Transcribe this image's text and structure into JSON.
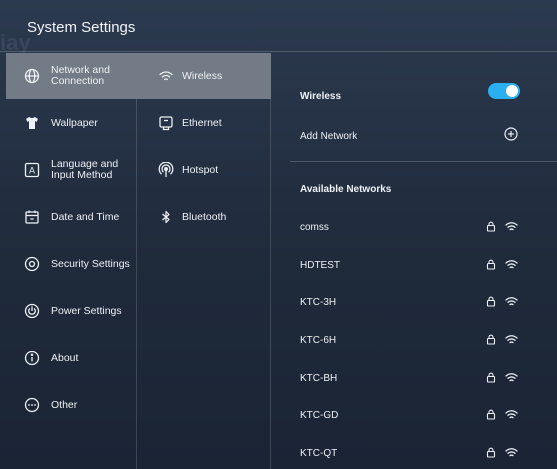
{
  "window": {
    "title": "System Settings",
    "watermark": "iay"
  },
  "categories": [
    {
      "label": "Network and Connection",
      "icon": "globe-icon",
      "active": true
    },
    {
      "label": "Wallpaper",
      "icon": "shirt-icon",
      "active": false
    },
    {
      "label": "Language and Input Method",
      "icon": "language-icon",
      "active": false
    },
    {
      "label": "Date and Time",
      "icon": "calendar-icon",
      "active": false
    },
    {
      "label": "Security Settings",
      "icon": "security-icon",
      "active": false
    },
    {
      "label": "Power Settings",
      "icon": "power-icon",
      "active": false
    },
    {
      "label": "About",
      "icon": "info-icon",
      "active": false
    },
    {
      "label": "Other",
      "icon": "more-icon",
      "active": false
    }
  ],
  "subcategories": [
    {
      "label": "Wireless",
      "icon": "wifi-icon",
      "active": true
    },
    {
      "label": "Ethernet",
      "icon": "ethernet-icon",
      "active": false
    },
    {
      "label": "Hotspot",
      "icon": "hotspot-icon",
      "active": false
    },
    {
      "label": "Bluetooth",
      "icon": "bluetooth-icon",
      "active": false
    }
  ],
  "wireless": {
    "label": "Wireless",
    "enabled": true,
    "add_network_label": "Add Network",
    "available_label": "Available Networks",
    "networks": [
      {
        "ssid": "comss",
        "secured": true
      },
      {
        "ssid": "HDTEST",
        "secured": true
      },
      {
        "ssid": "KTC-3H",
        "secured": true
      },
      {
        "ssid": "KTC-6H",
        "secured": true
      },
      {
        "ssid": "KTC-BH",
        "secured": true
      },
      {
        "ssid": "KTC-GD",
        "secured": true
      },
      {
        "ssid": "KTC-QT",
        "secured": true
      }
    ]
  },
  "colors": {
    "accent": "#2aaff0",
    "active_item": "#737b86"
  }
}
